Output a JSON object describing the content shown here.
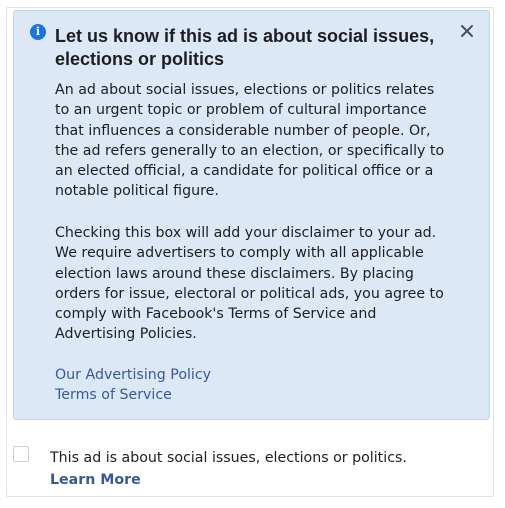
{
  "notice": {
    "info_icon_glyph": "i",
    "title": "Let us know if this ad is about social issues, elections or politics",
    "paragraph_1": "An ad about social issues, elections or politics relates to an urgent topic or problem of cultural importance that influences a considerable number of people. Or, the ad refers generally to an election, or specifically to an elected official, a candidate for political office or a notable political figure.",
    "paragraph_2": "Checking this box will add your disclaimer to your ad. We require advertisers to comply with all applicable election laws around these disclaimers. By placing orders for issue, electoral or political ads, you agree to comply with Facebook's Terms of Service and Advertising Policies.",
    "links": {
      "advertising_policy": "Our Advertising Policy",
      "terms_of_service": "Terms of Service"
    },
    "icons": {
      "info": "info-icon",
      "close": "close-icon"
    },
    "colors": {
      "background": "#dde8f6",
      "border": "#c2d4ec",
      "info_icon": "#1b74e4",
      "link": "#385898",
      "text": "#1c1e21"
    }
  },
  "checkbox": {
    "checked": false,
    "label": "This ad is about social issues, elections or politics.",
    "learn_more": "Learn More"
  }
}
